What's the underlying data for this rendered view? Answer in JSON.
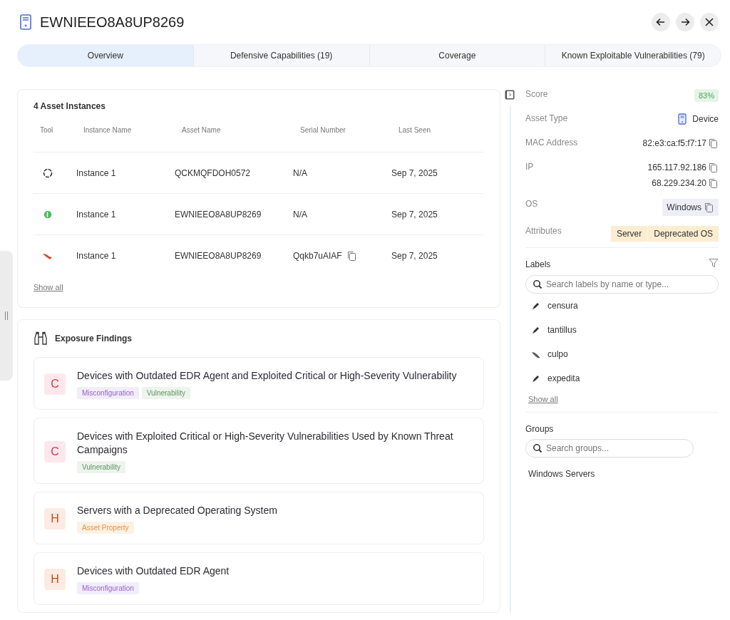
{
  "header": {
    "title": "EWNIEEO8A8UP8269",
    "buttons": [
      {
        "kind": "back"
      },
      {
        "kind": "forward"
      },
      {
        "kind": "close"
      }
    ]
  },
  "tabs": [
    {
      "label": "Overview",
      "selected": true
    },
    {
      "label": "Defensive Capabilities (19)",
      "selected": false
    },
    {
      "label": "Coverage",
      "selected": false
    },
    {
      "label": "Known Exploitable Vulnerabilities (79)",
      "selected": false
    }
  ],
  "instances": {
    "title": "4 Asset Instances",
    "columns": [
      "Tool",
      "Instance Name",
      "Asset Name",
      "Serial Number",
      "Last Seen"
    ],
    "rows": [
      {
        "kind": "ring",
        "instance": "Instance 1",
        "asset": "QCKMQFDOH0572",
        "serial": "N/A",
        "serial_copy": false,
        "last_seen": "Sep 7, 2025"
      },
      {
        "kind": "leaf",
        "instance": "Instance 1",
        "asset": "EWNIEEO8A8UP8269",
        "serial": "N/A",
        "serial_copy": false,
        "last_seen": "Sep 7, 2025"
      },
      {
        "kind": "bird",
        "instance": "Instance 1",
        "asset": "EWNIEEO8A8UP8269",
        "serial": "Qqkb7uAIAF",
        "serial_copy": true,
        "last_seen": "Sep 7, 2025"
      }
    ],
    "show_all": "Show all"
  },
  "findings": {
    "title": "Exposure Findings",
    "items": [
      {
        "kind": "critical",
        "letter": "C",
        "title": "Devices with Outdated EDR Agent and Exploited Critical or High-Severity Vulnerability",
        "tags": [
          {
            "kind": "misconfiguration",
            "label": "Misconfiguration"
          },
          {
            "kind": "vulnerability",
            "label": "Vulnerability"
          }
        ]
      },
      {
        "kind": "critical",
        "letter": "C",
        "title": "Devices with Exploited Critical or High-Severity Vulnerabilities Used by Known Threat Campaigns",
        "tags": [
          {
            "kind": "vulnerability",
            "label": "Vulnerability"
          }
        ]
      },
      {
        "kind": "high",
        "letter": "H",
        "title": "Servers with a Deprecated Operating System",
        "tags": [
          {
            "kind": "asset_property",
            "label": "Asset Property"
          }
        ]
      },
      {
        "kind": "high",
        "letter": "H",
        "title": "Devices with Outdated EDR Agent",
        "tags": [
          {
            "kind": "misconfiguration",
            "label": "Misconfiguration"
          }
        ]
      }
    ]
  },
  "details": {
    "score": {
      "label": "Score",
      "value": "83%"
    },
    "asset_type": {
      "label": "Asset Type",
      "value": "Device"
    },
    "mac": {
      "label": "MAC Address",
      "value": "82:e3:ca:f5:f7:17"
    },
    "ip": {
      "label": "IP",
      "values": [
        "165.117.92.186",
        "68.229.234.20"
      ]
    },
    "os": {
      "label": "OS",
      "value": "Windows"
    },
    "attributes": {
      "label": "Attributes",
      "values": [
        "Server",
        "Deprecated OS"
      ]
    }
  },
  "labels": {
    "title": "Labels",
    "placeholder": "Search labels by name or type...",
    "items": [
      {
        "kind": "pen",
        "name": "censura"
      },
      {
        "kind": "pen",
        "name": "tantillus"
      },
      {
        "kind": "feather",
        "name": "culpo"
      },
      {
        "kind": "pen",
        "name": "expedita"
      }
    ],
    "show_all": "Show all"
  },
  "groups": {
    "title": "Groups",
    "placeholder": "Search groups...",
    "items": [
      "Windows Servers"
    ]
  }
}
